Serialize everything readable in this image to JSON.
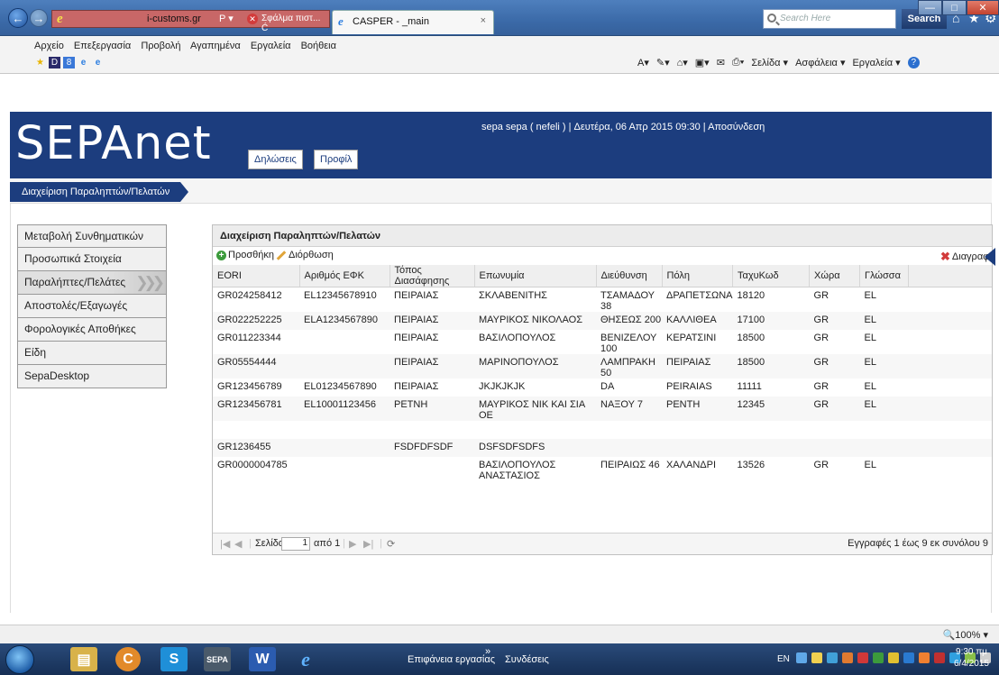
{
  "browser": {
    "address_url": "i-customs.gr",
    "address_search_glyph": "Ρ ▾",
    "address_error": "Σφάλμα πιστ... Ć",
    "tab_title": "CASPER - _main",
    "tab_close": "×",
    "search_placeholder": "Search Here",
    "search_button": "Search"
  },
  "menu": [
    "Αρχείο",
    "Επεξεργασία",
    "Προβολή",
    "Αγαπημένα",
    "Εργαλεία",
    "Βοήθεια"
  ],
  "command_bar": {
    "page": "Σελίδα ▾",
    "safety": "Ασφάλεια ▾",
    "tools": "Εργαλεία ▾"
  },
  "app": {
    "logo": "SEPAnet",
    "nav_declarations": "Δηλώσεις",
    "nav_profile": "Προφίλ",
    "user_info": "sepa sepa ( nefeli ) | Δευτέρα, 06 Απρ 2015 09:30 | Αποσύνδεση",
    "breadcrumb": "Διαχείριση Παραληπτών/Πελατών"
  },
  "sidebar": [
    "Μεταβολή Συνθηματικών",
    "Προσωπικά Στοιχεία",
    "Παραλήπτες/Πελάτες",
    "Αποστολές/Εξαγωγές",
    "Φορολογικές Αποθήκες",
    "Είδη",
    "SepaDesktop"
  ],
  "panel": {
    "title": "Διαχείριση Παραληπτών/Πελατών",
    "add": "Προσθήκη",
    "edit": "Διόρθωση",
    "delete": "Διαγραφ",
    "columns": [
      "EORI",
      "Αριθμός ΕΦΚ",
      "Τόπος Διασάφησης",
      "Επωνυμία",
      "Διεύθυνση",
      "Πόλη",
      "ΤαχυΚωδ",
      "Χώρα",
      "Γλώσσα"
    ],
    "rows": [
      [
        "GR024258412",
        "EL12345678910",
        "ΠΕΙΡΑΙΑΣ",
        "ΣΚΛΑΒΕΝΙΤΗΣ",
        "ΤΣΑΜΑΔΟΥ 38",
        "ΔΡΑΠΕΤΣΩΝΑ",
        "18120",
        "GR",
        "EL"
      ],
      [
        "GR022252225",
        "ELA1234567890",
        "ΠΕΙΡΑΙΑΣ",
        "ΜΑΥΡΙΚΟΣ ΝΙΚΟΛΑΟΣ",
        "ΘΗΣΕΩΣ 200",
        "ΚΑΛΛΙΘΕΑ",
        "17100",
        "GR",
        "EL"
      ],
      [
        "GR011223344",
        "",
        "ΠΕΙΡΑΙΑΣ",
        "ΒΑΣΙΛΟΠΟΥΛΟΣ",
        "ΒΕΝΙΖΕΛΟΥ 100",
        "ΚΕΡΑΤΣΙΝΙ",
        "18500",
        "GR",
        "EL"
      ],
      [
        "GR05554444",
        "",
        "ΠΕΙΡΑΙΑΣ",
        "ΜΑΡΙΝΟΠΟΥΛΟΣ",
        "ΛΑΜΠΡΑΚΗ 50",
        "ΠΕΙΡΑΙΑΣ",
        "18500",
        "GR",
        "EL"
      ],
      [
        "GR123456789",
        "EL01234567890",
        "ΠΕΙΡΑΙΑΣ",
        "JKJKJKJK",
        "DA",
        "PEIRAIAS",
        "11111",
        "GR",
        "EL"
      ],
      [
        "GR123456781",
        "EL10001123456",
        "ΡΕΤΝΗ",
        "ΜΑΥΡΙΚΟΣ ΝΙΚ ΚΑΙ ΣΙΑ ΟΕ",
        "ΝΑΞΟΥ 7",
        "PENTH",
        "12345",
        "GR",
        "EL"
      ],
      [
        "",
        "",
        "",
        "",
        "",
        "",
        "",
        "",
        ""
      ],
      [
        "GR1236455",
        "",
        "FSDFDFSDF",
        "DSFSDFSDFS",
        "",
        "",
        "",
        "",
        ""
      ],
      [
        "GR0000004785",
        "",
        "",
        "ΒΑΣΙΛΟΠΟΥΛΟΣ ΑΝΑΣΤΑΣΙΟΣ",
        "ΠΕΙΡΑΙΩΣ 46",
        "ΧΑΛΑΝΔΡΙ",
        "13526",
        "GR",
        "EL"
      ]
    ],
    "pager_page_label": "Σελίδα",
    "pager_page_value": "1",
    "pager_of": "από 1",
    "records": "Εγγραφές 1 έως 9 εκ συνόλου 9"
  },
  "status": {
    "zoom": "100%  ▾"
  },
  "taskbar": {
    "desktop": "Επιφάνεια εργασίας",
    "links": "Συνδέσεις",
    "lang": "EN",
    "time": "9:30 πμ",
    "date": "6/4/2015"
  },
  "colors": {
    "brand": "#1c3d7e",
    "accent_green": "#3c9b3c",
    "delete_red": "#d23b3b"
  }
}
